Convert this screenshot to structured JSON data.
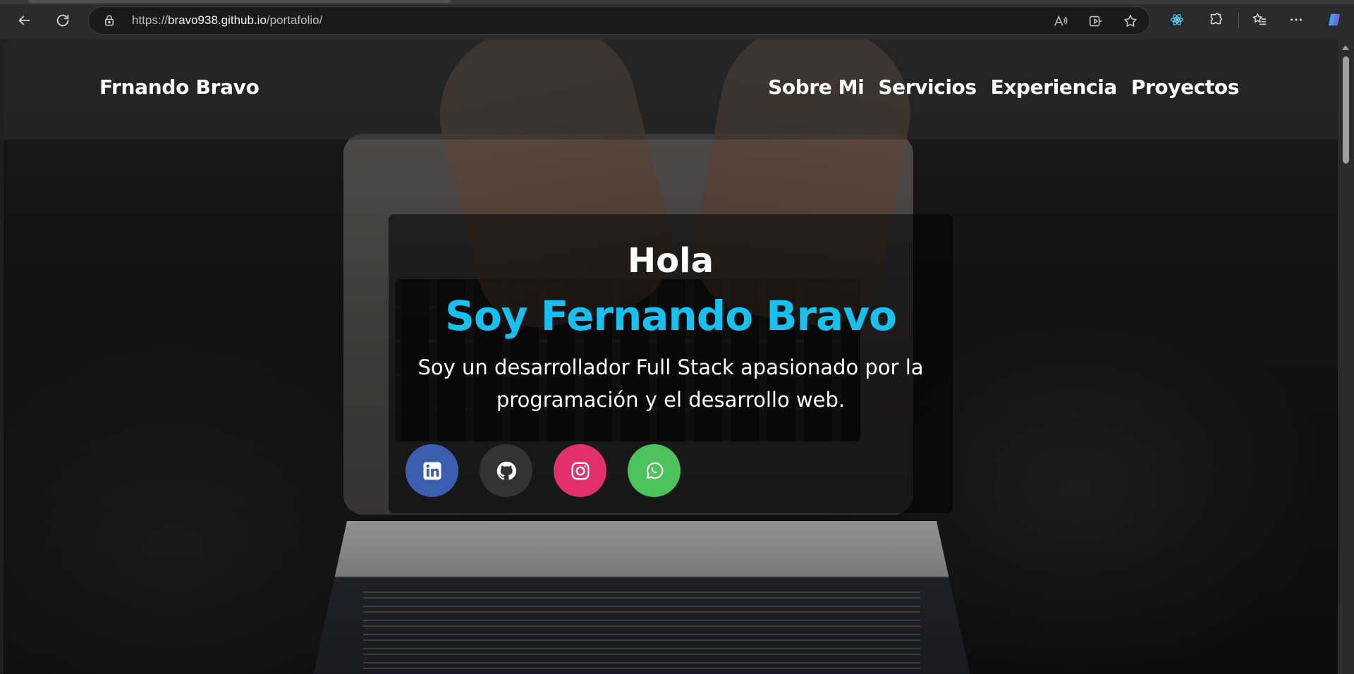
{
  "browser": {
    "url_prefix": "https://",
    "url_host": "bravo938.github.io",
    "url_path": "/portafolio/",
    "icons": [
      "back-icon",
      "reload-icon",
      "lock-icon",
      "read-aloud-icon",
      "immersive-reader-icon",
      "favorite-star-icon",
      "react-devtools-icon",
      "extensions-icon",
      "favorites-icon",
      "more-icon",
      "copilot-icon"
    ]
  },
  "site": {
    "brand": "Frnando Bravo",
    "nav": [
      "Sobre Mi",
      "Servicios",
      "Experiencia",
      "Proyectos"
    ]
  },
  "hero": {
    "greeting": "Hola",
    "name": "Soy Fernando Bravo",
    "description": "Soy un desarrollador Full Stack apasionado por la programación y el desarrollo web.",
    "social": [
      {
        "name": "linkedin-icon",
        "color": "#3b5fae"
      },
      {
        "name": "github-icon",
        "color": "#333333"
      },
      {
        "name": "instagram-icon",
        "color": "#e1306c"
      },
      {
        "name": "whatsapp-icon",
        "color": "#4bc25a"
      }
    ]
  },
  "colors": {
    "accent": "#16c1f0",
    "text": "#ffffff"
  }
}
